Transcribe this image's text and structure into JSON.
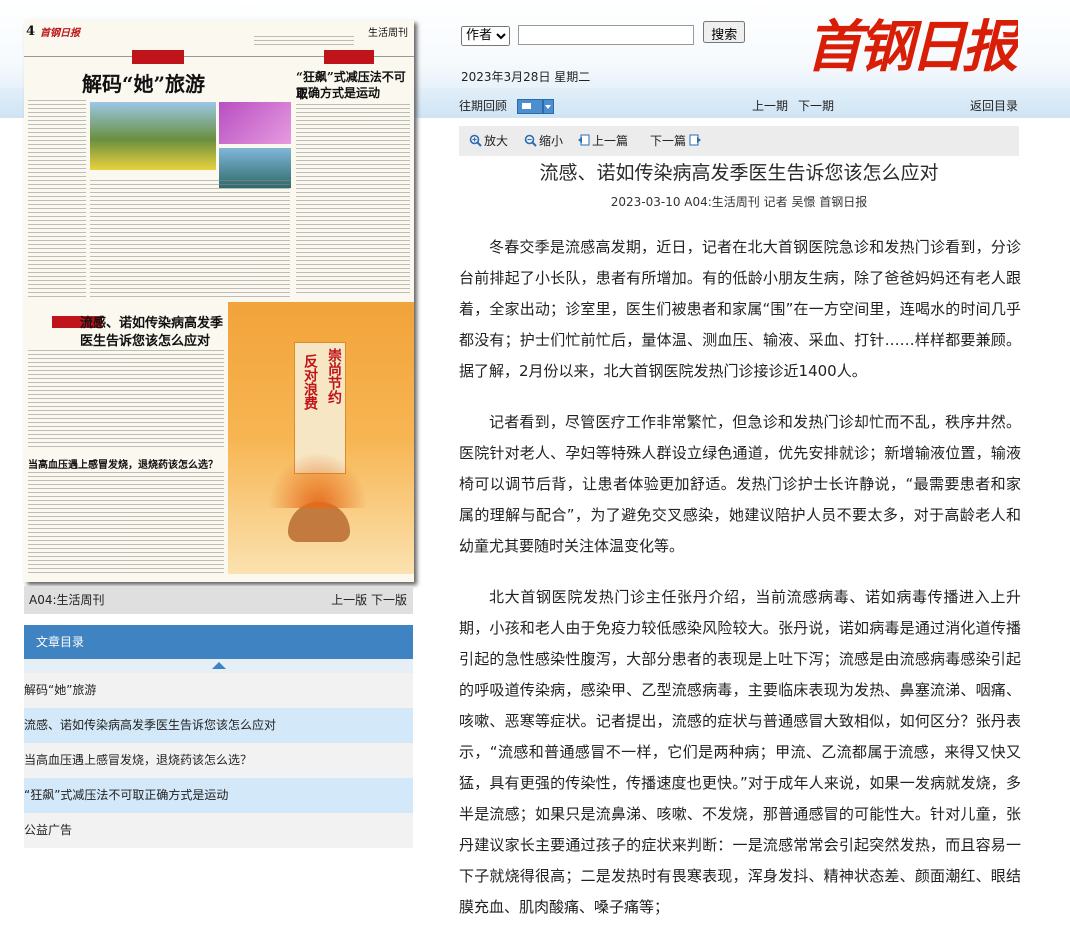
{
  "search": {
    "select_value": "作者",
    "placeholder": "",
    "button": "搜索"
  },
  "logo": {
    "text": "首钢日报"
  },
  "date": "2023年3月28日 星期二",
  "nav": {
    "archive": "往期回顾",
    "prev_issue": "上一期",
    "next_issue": "下一期",
    "back": "返回目录"
  },
  "toolbar": {
    "zoom_in": "放大",
    "zoom_out": "缩小",
    "prev": "上一篇",
    "next": "下一篇"
  },
  "thumbnail": {
    "page_label": "A04:生活周刊",
    "prev_page": "上一版",
    "next_page": "下一版",
    "page_no": "4",
    "paper_name": "首钢日报",
    "section": "生活周刊",
    "headline1": "解码“她”旅游",
    "headline2_a": "“狂飙”式减压法不可取",
    "headline2_b": "正确方式是运动",
    "headline3_a": "流感、诺如传染病高发季",
    "headline3_b": "医生告诉您该怎么应对",
    "headline4": "当高血压遇上感冒发烧，退烧药该怎么选？",
    "poster_a": "崇尚节约",
    "poster_b": "反对浪费"
  },
  "toc": {
    "title": "文章目录",
    "items": [
      "解码“她”旅游",
      "流感、诺如传染病高发季医生告诉您该怎么应对",
      "当高血压遇上感冒发烧，退烧药该怎么选？",
      "“狂飙”式减压法不可取正确方式是运动",
      "公益广告"
    ]
  },
  "article": {
    "title": "流感、诺如传染病高发季医生告诉您该怎么应对",
    "meta": "2023-03-10   A04:生活周刊   记者 吴憬   首钢日报",
    "paragraphs": [
      "冬春交季是流感高发期，近日，记者在北大首钢医院急诊和发热门诊看到，分诊台前排起了小长队，患者有所增加。有的低龄小朋友生病，除了爸爸妈妈还有老人跟着，全家出动；诊室里，医生们被患者和家属“围”在一方空间里，连喝水的时间几乎都没有；护士们忙前忙后，量体温、测血压、输液、采血、打针……样样都要兼顾。据了解，2月份以来，北大首钢医院发热门诊接诊近1400人。",
      "记者看到，尽管医疗工作非常繁忙，但急诊和发热门诊却忙而不乱，秩序井然。医院针对老人、孕妇等特殊人群设立绿色通道，优先安排就诊；新增输液位置，输液椅可以调节后背，让患者体验更加舒适。发热门诊护士长许静说，“最需要患者和家属的理解与配合”，为了避免交叉感染，她建议陪护人员不要太多，对于高龄老人和幼童尤其要随时关注体温变化等。",
      "北大首钢医院发热门诊主任张丹介绍，当前流感病毒、诺如病毒传播进入上升期，小孩和老人由于免疫力较低感染风险较大。张丹说，诺如病毒是通过消化道传播引起的急性感染性腹泻，大部分患者的表现是上吐下泻；流感是由流感病毒感染引起的呼吸道传染病，感染甲、乙型流感病毒，主要临床表现为发热、鼻塞流涕、咽痛、咳嗽、恶寒等症状。记者提出，流感的症状与普通感冒大致相似，如何区分？张丹表示，“流感和普通感冒不一样，它们是两种病；甲流、乙流都属于流感，来得又快又猛，具有更强的传染性，传播速度也更快。”对于成年人来说，如果一发病就发烧，多半是流感；如果只是流鼻涕、咳嗽、不发烧，那普通感冒的可能性大。针对儿童，张丹建议家长主要通过孩子的症状来判断：一是流感常常会引起突然发热，而且容易一下子就烧得很高；二是发热时有畏寒表现，浑身发抖、精神状态差、颜面潮红、眼结膜充血、肌肉酸痛、嗓子痛等；"
    ]
  },
  "colors": {
    "accent": "#3f83c2",
    "logo_red": "#d81e06",
    "toc_alt": "#d3e8f8"
  }
}
